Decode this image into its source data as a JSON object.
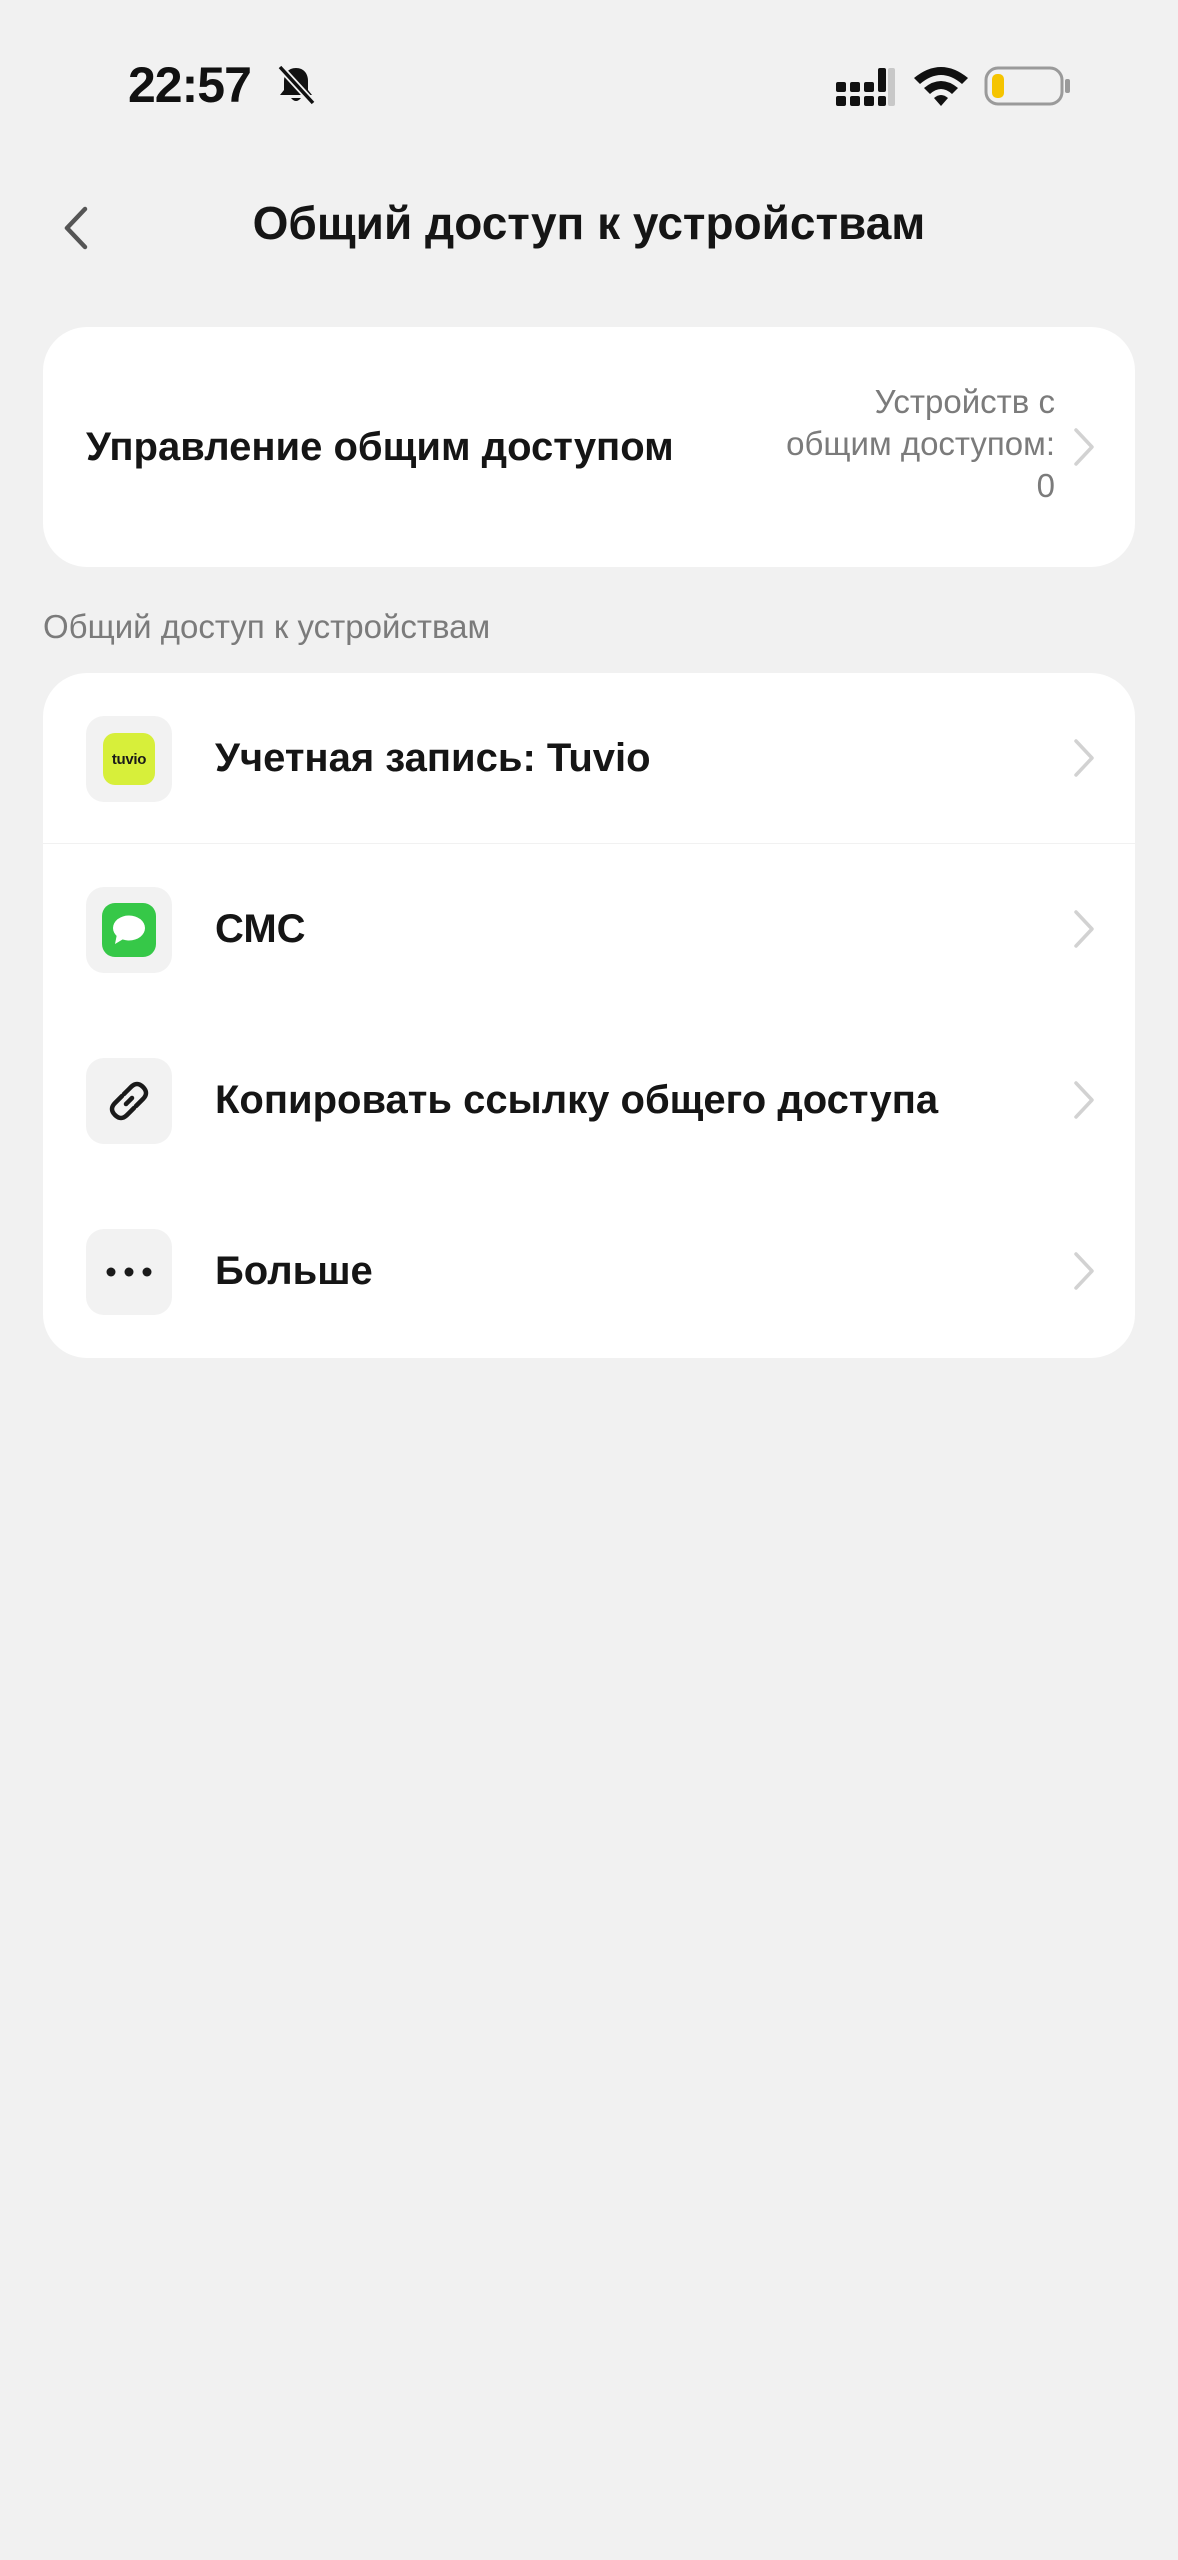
{
  "status_bar": {
    "time": "22:57",
    "icons": [
      "bell-muted-icon",
      "signal-icon",
      "wifi-icon",
      "battery-low-icon"
    ],
    "battery_color": "#f5c400"
  },
  "header": {
    "title": "Общий доступ к устройствам",
    "back_icon": "chevron-left-icon"
  },
  "manage_card": {
    "label": "Управление общим доступом",
    "value_line1": "Устройств с",
    "value_line2": "общим доступом:",
    "value_line3": "0"
  },
  "share_section": {
    "label": "Общий доступ к устройствам",
    "items": [
      {
        "label": "Учетная запись: Tuvio",
        "icon": "tuvio-logo-icon",
        "icon_text": "tuvio"
      },
      {
        "label": "СМС",
        "icon": "message-icon"
      },
      {
        "label": "Копировать ссылку общего доступа",
        "icon": "link-icon"
      },
      {
        "label": "Больше",
        "icon": "more-dots-icon"
      }
    ]
  },
  "colors": {
    "background": "#f1f1f1",
    "card": "#ffffff",
    "tuvio_brand": "#d7ef3a",
    "sms_green": "#36c848",
    "secondary_text": "#7b7b7b"
  }
}
